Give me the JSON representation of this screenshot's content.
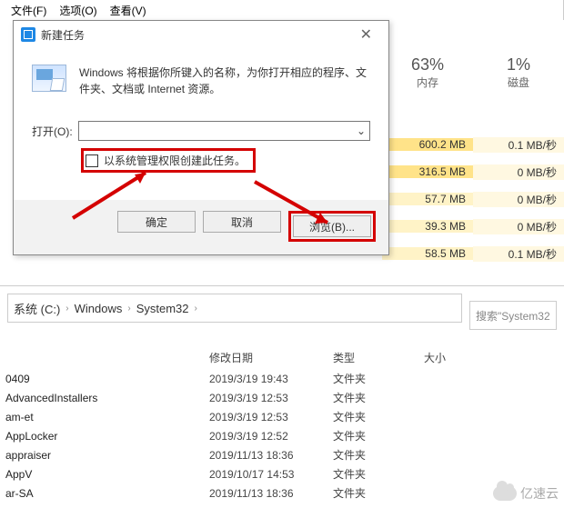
{
  "menubar": {
    "file": "文件(F)",
    "options": "选项(O)",
    "view": "查看(V)"
  },
  "dialog": {
    "title": "新建任务",
    "desc": "Windows 将根据你所键入的名称，为你打开相应的程序、文件夹、文档或 Internet 资源。",
    "open_label": "打开(O):",
    "combo_value": "",
    "admin_checkbox": "以系统管理权限创建此任务。",
    "ok": "确定",
    "cancel": "取消",
    "browse": "浏览(B)..."
  },
  "taskmgr": {
    "headers": {
      "mem_pct": "63%",
      "mem_lbl": "内存",
      "disk_pct": "1%",
      "disk_lbl": "磁盘"
    },
    "rows": [
      {
        "mem": "600.2 MB",
        "disk": "0.1 MB/秒",
        "mem_shade": "shade1",
        "disk_shade": "shade2",
        "extra": "0.1 M"
      },
      {
        "mem": "316.5 MB",
        "disk": "0 MB/秒",
        "mem_shade": "shade1",
        "disk_shade": "shade2",
        "extra": "0 M"
      },
      {
        "mem": "57.7 MB",
        "disk": "0 MB/秒",
        "mem_shade": "shade0",
        "disk_shade": "shade2",
        "extra": "0 M"
      },
      {
        "mem": "39.3 MB",
        "disk": "0 MB/秒",
        "mem_shade": "shade0",
        "disk_shade": "shade2",
        "extra": "0 M"
      },
      {
        "mem": "58.5 MB",
        "disk": "0.1 MB/秒",
        "mem_shade": "shade0",
        "disk_shade": "shade2",
        "extra": "0.1 M"
      }
    ]
  },
  "explorer": {
    "breadcrumbs": [
      "系统 (C:)",
      "Windows",
      "System32"
    ],
    "search_placeholder": "搜索\"System32",
    "columns": {
      "date": "修改日期",
      "type": "类型",
      "size": "大小"
    },
    "files": [
      {
        "name": "0409",
        "date": "2019/3/19 19:43",
        "type": "文件夹"
      },
      {
        "name": "AdvancedInstallers",
        "date": "2019/3/19 12:53",
        "type": "文件夹"
      },
      {
        "name": "am-et",
        "date": "2019/3/19 12:53",
        "type": "文件夹"
      },
      {
        "name": "AppLocker",
        "date": "2019/3/19 12:52",
        "type": "文件夹"
      },
      {
        "name": "appraiser",
        "date": "2019/11/13 18:36",
        "type": "文件夹"
      },
      {
        "name": "AppV",
        "date": "2019/10/17 14:53",
        "type": "文件夹"
      },
      {
        "name": "ar-SA",
        "date": "2019/11/13 18:36",
        "type": "文件夹"
      }
    ]
  },
  "watermark": "亿速云"
}
